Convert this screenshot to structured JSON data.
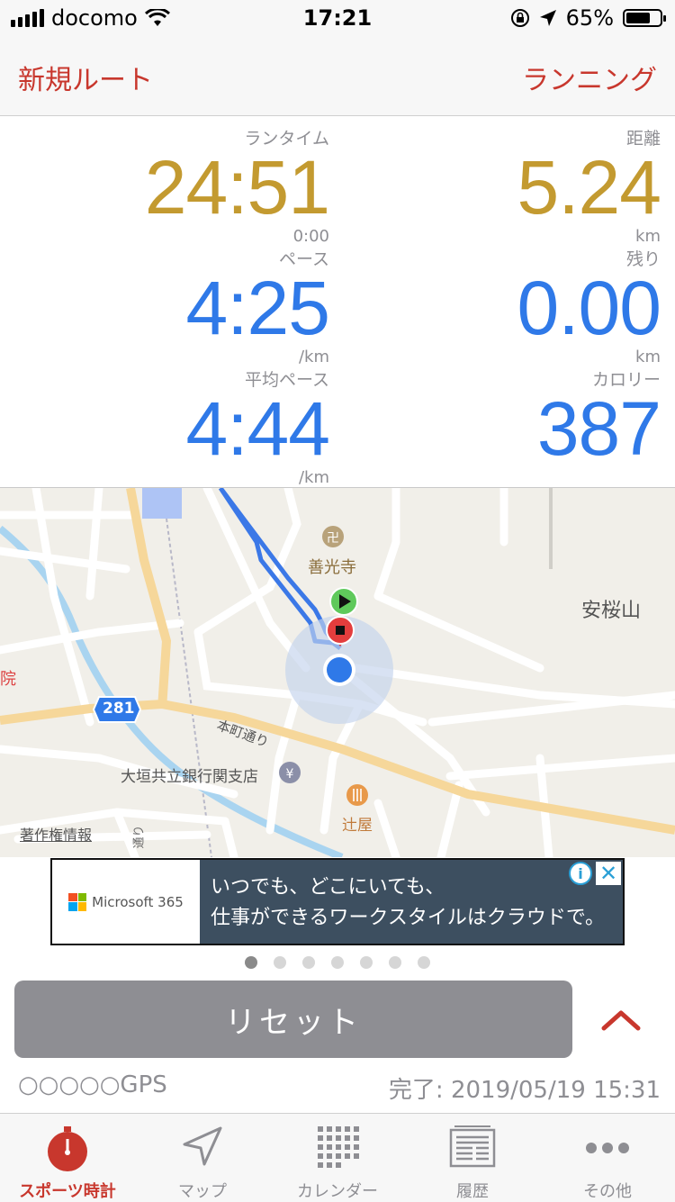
{
  "status_bar": {
    "carrier": "docomo",
    "time": "17:21",
    "battery": "65%"
  },
  "nav": {
    "left_label": "新規ルート",
    "right_label": "ランニング"
  },
  "stats": {
    "run_time": {
      "label": "ランタイム",
      "value": "24:51",
      "sub": "0:00"
    },
    "distance": {
      "label": "距離",
      "value": "5.24",
      "unit": "km"
    },
    "pace": {
      "label": "ペース",
      "value": "4:25",
      "unit": "/km"
    },
    "remaining": {
      "label": "残り",
      "value": "0.00",
      "unit": "km"
    },
    "avg_pace": {
      "label": "平均ペース",
      "value": "4:44",
      "unit": "/km"
    },
    "calories": {
      "label": "カロリー",
      "value": "387"
    }
  },
  "map": {
    "labels": {
      "temple": "善光寺",
      "mountain": "安桜山",
      "hospital": "医院",
      "route_number": "281",
      "street": "本町通り",
      "bank": "大垣共立銀行関支店",
      "restaurant": "辻屋",
      "copyright": "著作権情報",
      "street2": "通り"
    }
  },
  "ad": {
    "brand": "Microsoft 365",
    "line1": "いつでも、どこにいても、",
    "line2": "仕事ができるワークスタイルはクラウドで。",
    "info": "i",
    "close": "✕"
  },
  "pager": {
    "count": 7,
    "active": 0
  },
  "reset_label": "リセット",
  "gps_status": "○○○○○GPS",
  "completed": "完了: 2019/05/19 15:31",
  "tabs": [
    {
      "label": "スポーツ時計",
      "icon": "stopwatch-icon"
    },
    {
      "label": "マップ",
      "icon": "navigation-arrow-icon"
    },
    {
      "label": "カレンダー",
      "icon": "calendar-grid-icon"
    },
    {
      "label": "履歴",
      "icon": "history-list-icon"
    },
    {
      "label": "その他",
      "icon": "more-dots-icon"
    }
  ],
  "colors": {
    "accent": "#c8372d",
    "gold": "#c39a30",
    "blue": "#2f79e8",
    "route": "#3b78e7"
  }
}
